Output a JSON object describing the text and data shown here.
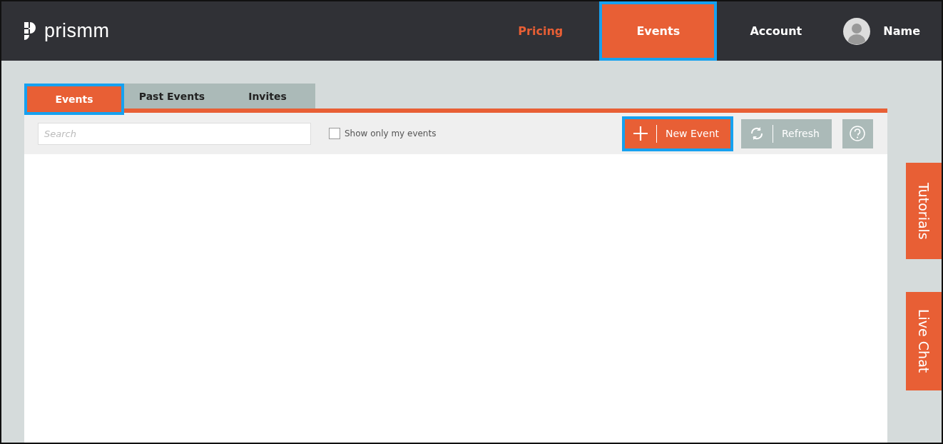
{
  "header": {
    "logo": "prismm",
    "nav": [
      {
        "label": "Pricing",
        "selected": false,
        "highlighted": false
      },
      {
        "label": "Events",
        "selected": true,
        "highlighted": true
      },
      {
        "label": "Account",
        "selected": false,
        "highlighted": false
      }
    ],
    "user": {
      "name": "Name"
    }
  },
  "tabs": [
    {
      "label": "Events",
      "selected": true,
      "highlighted": true
    },
    {
      "label": "Past Events",
      "selected": false,
      "highlighted": false
    },
    {
      "label": "Invites",
      "selected": false,
      "highlighted": false
    }
  ],
  "toolbar": {
    "search": {
      "placeholder": "Search"
    },
    "filter": {
      "label": "Show only my events",
      "checked": false
    },
    "buttons": [
      {
        "kind": "new",
        "label": "New Event",
        "highlighted": true
      },
      {
        "kind": "refresh",
        "label": "Refresh",
        "highlighted": false
      },
      {
        "kind": "help",
        "highlighted": false
      }
    ]
  },
  "side_tabs": [
    {
      "label": "Tutorials"
    },
    {
      "label": "Live Chat"
    }
  ]
}
